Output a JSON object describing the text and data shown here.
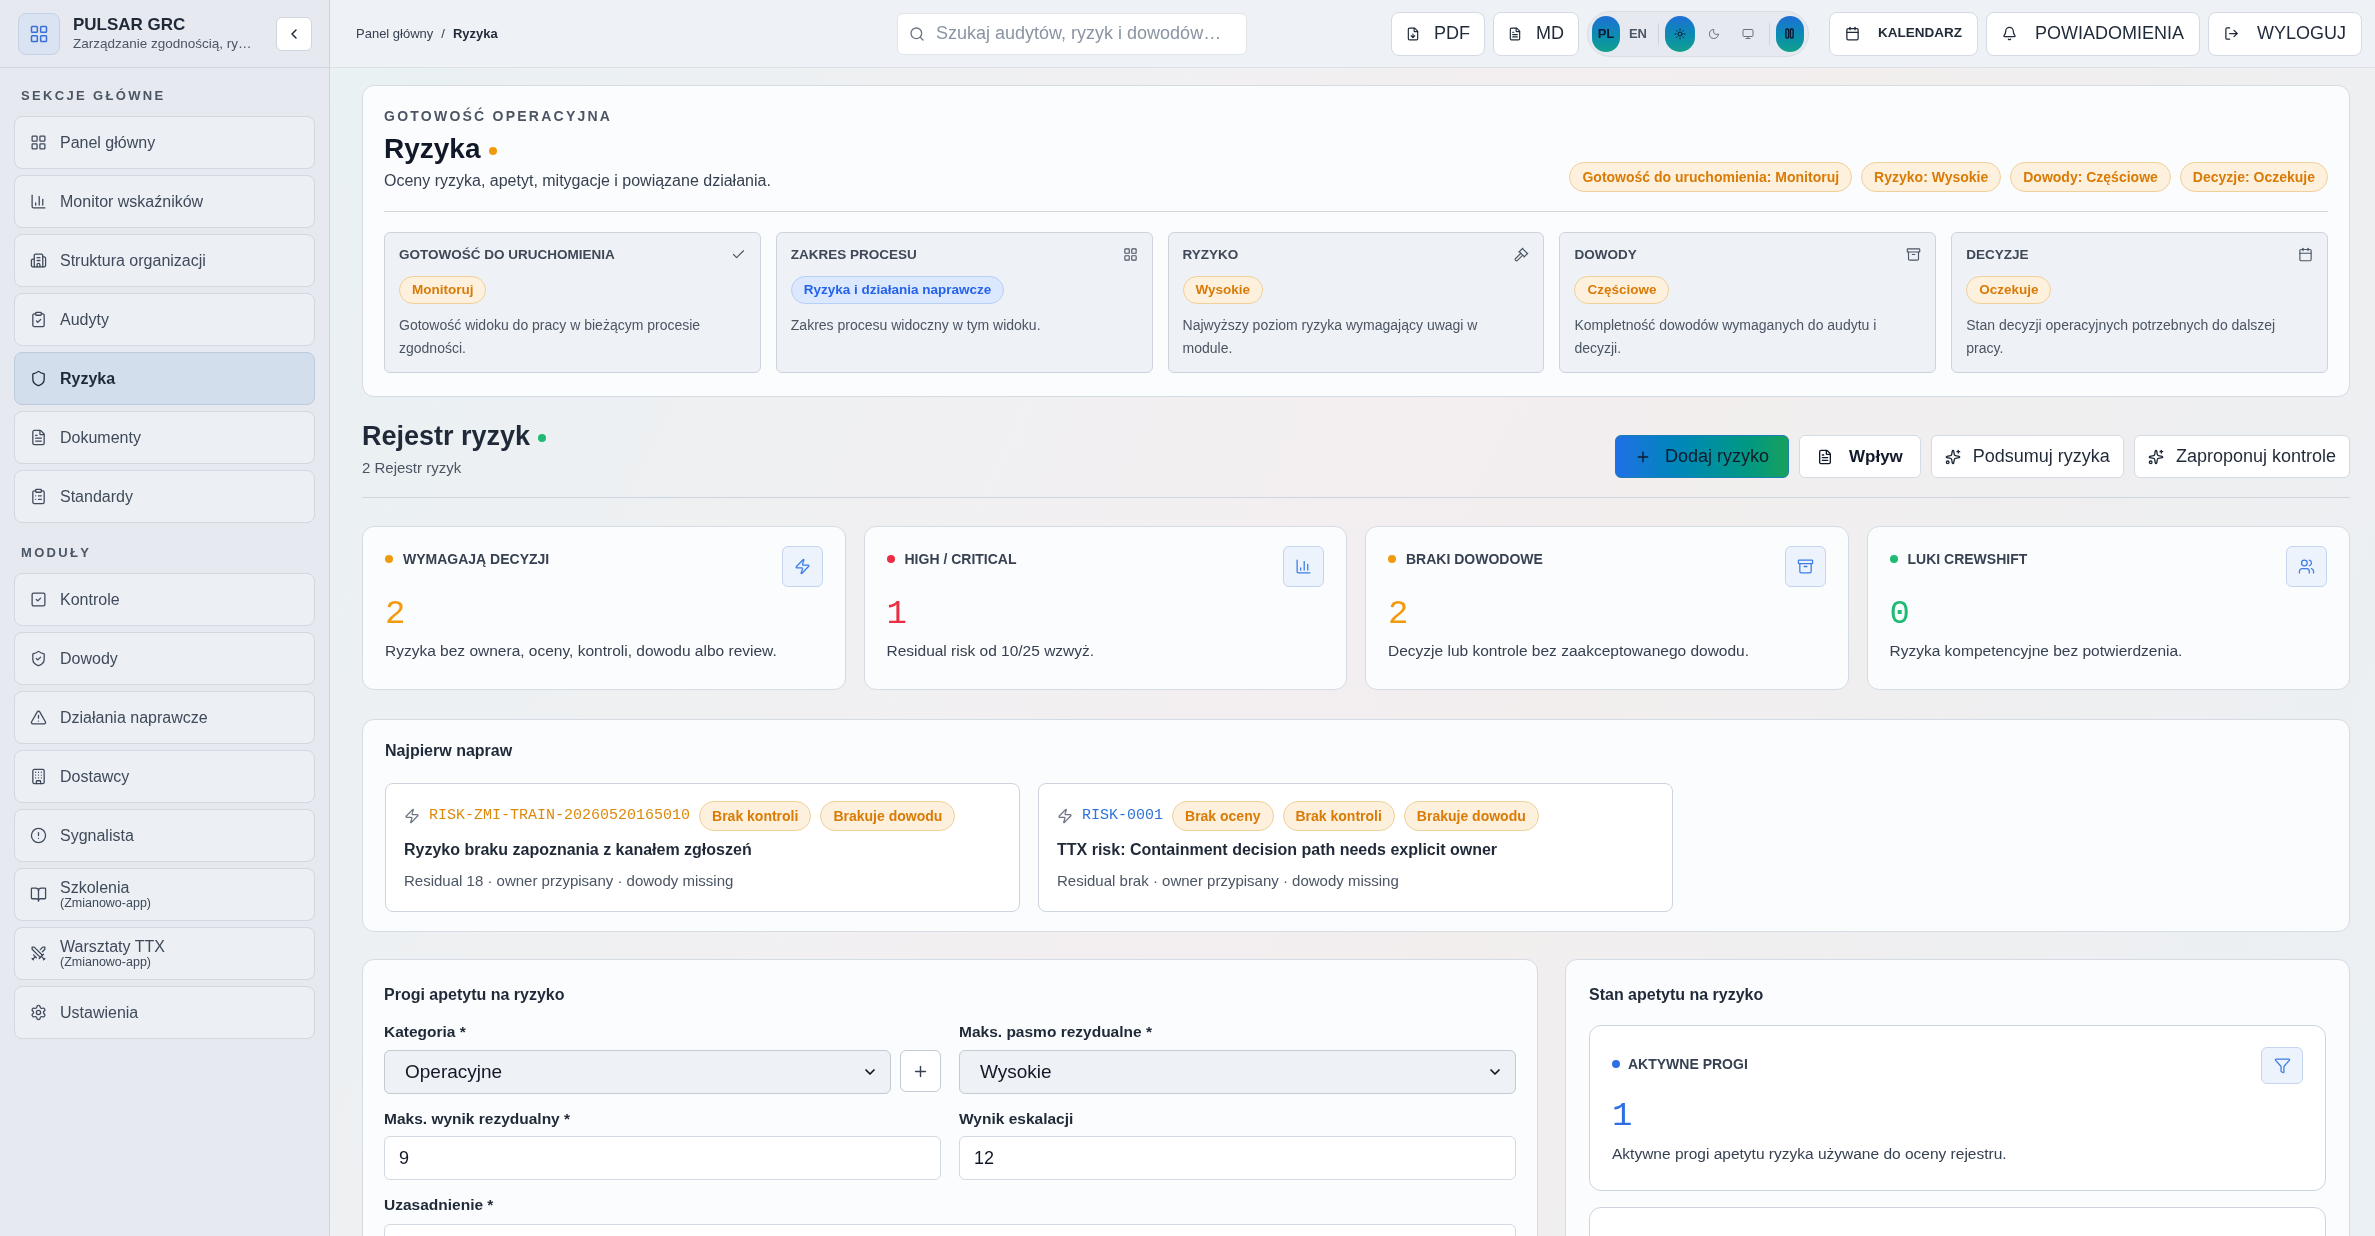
{
  "sidebar": {
    "brand": {
      "title": "PULSAR GRC",
      "subtitle": "Zarządzanie zgodnością, ry…"
    },
    "sections": [
      {
        "label": "SEKCJE GŁÓWNE",
        "items": [
          {
            "label": "Panel główny",
            "selected": false
          },
          {
            "label": "Monitor wskaźników",
            "selected": false
          },
          {
            "label": "Struktura organizacji",
            "selected": false
          },
          {
            "label": "Audyty",
            "selected": false
          },
          {
            "label": "Ryzyka",
            "selected": true
          },
          {
            "label": "Dokumenty",
            "selected": false
          },
          {
            "label": "Standardy",
            "selected": false
          }
        ]
      },
      {
        "label": "MODUŁY",
        "items": [
          {
            "label": "Kontrole",
            "selected": false
          },
          {
            "label": "Dowody",
            "selected": false
          },
          {
            "label": "Działania naprawcze",
            "selected": false
          },
          {
            "label": "Dostawcy",
            "selected": false
          },
          {
            "label": "Sygnalista",
            "selected": false
          },
          {
            "label": "Szkolenia",
            "sublabel": "(Zmianowo-app)",
            "selected": false
          },
          {
            "label": "Warsztaty TTX",
            "sublabel": "(Zmianowo-app)",
            "selected": false
          },
          {
            "label": "Ustawienia",
            "selected": false
          }
        ]
      }
    ]
  },
  "topbar": {
    "breadcrumb": {
      "items": [
        "Panel główny",
        "Ryzyka"
      ],
      "separator": "/"
    },
    "search": {
      "placeholder": "Szukaj audytów, ryzyk i dowodów…"
    },
    "exports": [
      "PDF",
      "MD"
    ],
    "languages": [
      {
        "label": "PL",
        "selected": true
      },
      {
        "label": "EN",
        "selected": false
      }
    ],
    "themes": [
      {
        "kind": "light",
        "selected": true
      },
      {
        "kind": "dark",
        "selected": false
      },
      {
        "kind": "system",
        "selected": false
      }
    ],
    "layout_toggle": {
      "on": true
    },
    "actions": [
      {
        "label": "KALENDARZ",
        "kind": "calendar"
      },
      {
        "label": "POWIADOMIENIA",
        "kind": "notifications"
      },
      {
        "label": "WYLOGUJ",
        "kind": "logout"
      }
    ]
  },
  "readiness": {
    "eyebrow": "GOTOWOŚĆ OPERACYJNA",
    "title": "Ryzyka",
    "subtitle": "Oceny ryzyka, apetyt, mitygacje i powiązane działania.",
    "badges": [
      "Gotowość do uruchomienia: Monitoruj",
      "Ryzyko: Wysokie",
      "Dowody: Częściowe",
      "Decyzje: Oczekuje"
    ],
    "tiles": [
      {
        "title": "GOTOWOŚĆ DO URUCHOMIENIA",
        "badge": "Monitoruj",
        "kind": "warning",
        "description": "Gotowość widoku do pracy w bieżącym procesie zgodności."
      },
      {
        "title": "ZAKRES PROCESU",
        "badge": "Ryzyka i działania naprawcze",
        "kind": "info",
        "description": "Zakres procesu widoczny w tym widoku."
      },
      {
        "title": "RYZYKO",
        "badge": "Wysokie",
        "kind": "warning",
        "description": "Najwyższy poziom ryzyka wymagający uwagi w module."
      },
      {
        "title": "DOWODY",
        "badge": "Częściowe",
        "kind": "warning",
        "description": "Kompletność dowodów wymaganych do audytu i decyzji."
      },
      {
        "title": "DECYZJE",
        "badge": "Oczekuje",
        "kind": "warning",
        "description": "Stan decyzji operacyjnych potrzebnych do dalszej pracy."
      }
    ]
  },
  "register": {
    "title": "Rejestr ryzyk",
    "subtitle": "2 Rejestr ryzyk",
    "actions": [
      {
        "label": "Dodaj ryzyko",
        "kind": "primary"
      },
      {
        "label": "Wpływ",
        "kind": "document"
      },
      {
        "label": "Podsumuj ryzyka",
        "kind": "sparkle"
      },
      {
        "label": "Zaproponuj kontrole",
        "kind": "sparkle"
      }
    ]
  },
  "stats": [
    {
      "label": "WYMAGAJĄ DECYZJI",
      "color": "#f29a0e",
      "value": "2",
      "description": "Ryzyka bez ownera, oceny, kontroli, dowodu albo review."
    },
    {
      "label": "HIGH / CRITICAL",
      "color": "#ea2f45",
      "value": "1",
      "description": "Residual risk od 10/25 wzwyż."
    },
    {
      "label": "BRAKI DOWODOWE",
      "color": "#f29a0e",
      "value": "2",
      "description": "Decyzje lub kontrole bez zaakceptowanego dowodu."
    },
    {
      "label": "LUKI CREWSHIFT",
      "color": "#1fba74",
      "value": "0",
      "description": "Ryzyka kompetencyjne bez potwierdzenia."
    }
  ],
  "fix_first": {
    "title": "Najpierw napraw",
    "items": [
      {
        "id": "RISK-ZMI-TRAIN-20260520165010",
        "color": "#dc8a0c",
        "tags": [
          "Brak kontroli",
          "Brakuje dowodu"
        ],
        "title": "Ryzyko braku zapoznania z kanałem zgłoszeń",
        "meta": "Residual 18 · owner przypisany · dowody missing"
      },
      {
        "id": "RISK-0001",
        "color": "#2f74d9",
        "tags": [
          "Brak oceny",
          "Brak kontroli",
          "Brakuje dowodu"
        ],
        "title": "TTX risk: Containment decision path needs explicit owner",
        "meta": "Residual brak · owner przypisany · dowody missing"
      }
    ]
  },
  "appetite_form": {
    "title": "Progi apetytu na ryzyko",
    "fields": [
      {
        "label": "Kategoria *",
        "kind": "select",
        "value": "Operacyjne",
        "addable": true
      },
      {
        "label": "Maks. pasmo rezydualne *",
        "kind": "select",
        "value": "Wysokie"
      },
      {
        "label": "Maks. wynik rezydualny *",
        "kind": "input",
        "value": "9"
      },
      {
        "label": "Wynik eskalacji",
        "kind": "input",
        "value": "12"
      },
      {
        "label": "Uzasadnienie *",
        "kind": "textarea"
      }
    ]
  },
  "appetite_state": {
    "title": "Stan apetytu na ryzyko",
    "cards": [
      {
        "label": "AKTYWNE PROGI",
        "color": "#2f6fe4",
        "value": "1",
        "description": "Aktywne progi apetytu ryzyka używane do oceny rejestru."
      }
    ]
  }
}
